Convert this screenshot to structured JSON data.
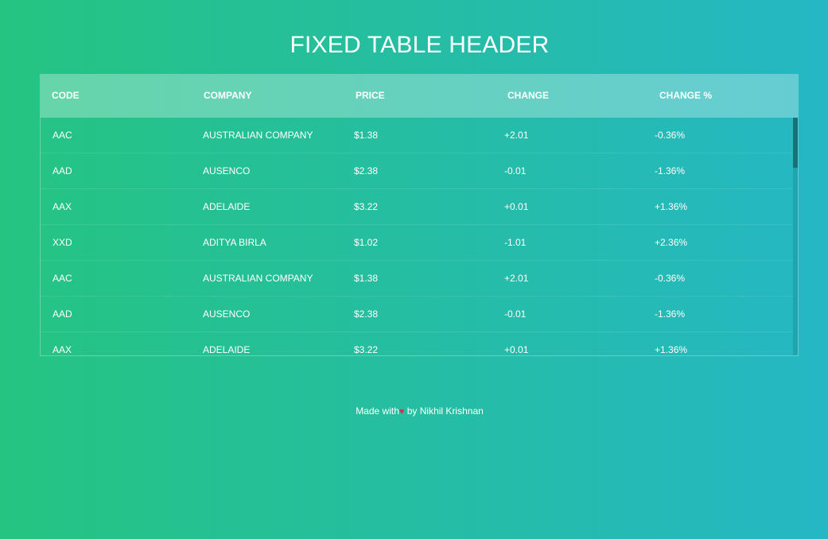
{
  "title": "FIXED TABLE HEADER",
  "table": {
    "headers": [
      "CODE",
      "COMPANY",
      "PRICE",
      "CHANGE",
      "CHANGE %"
    ],
    "rows": [
      [
        "AAC",
        "AUSTRALIAN COMPANY",
        "$1.38",
        "+2.01",
        "-0.36%"
      ],
      [
        "AAD",
        "AUSENCO",
        "$2.38",
        "-0.01",
        "-1.36%"
      ],
      [
        "AAX",
        "ADELAIDE",
        "$3.22",
        "+0.01",
        "+1.36%"
      ],
      [
        "XXD",
        "ADITYA BIRLA",
        "$1.02",
        "-1.01",
        "+2.36%"
      ],
      [
        "AAC",
        "AUSTRALIAN COMPANY",
        "$1.38",
        "+2.01",
        "-0.36%"
      ],
      [
        "AAD",
        "AUSENCO",
        "$2.38",
        "-0.01",
        "-1.36%"
      ],
      [
        "AAX",
        "ADELAIDE",
        "$3.22",
        "+0.01",
        "+1.36%"
      ]
    ]
  },
  "footer": {
    "made_with": "Made with",
    "heart": "♥",
    "by": " by Nikhil Krishnan"
  },
  "colors": {
    "gradient_start": "#25c481",
    "gradient_end": "#25b7c4",
    "heart": "#e2264d"
  }
}
